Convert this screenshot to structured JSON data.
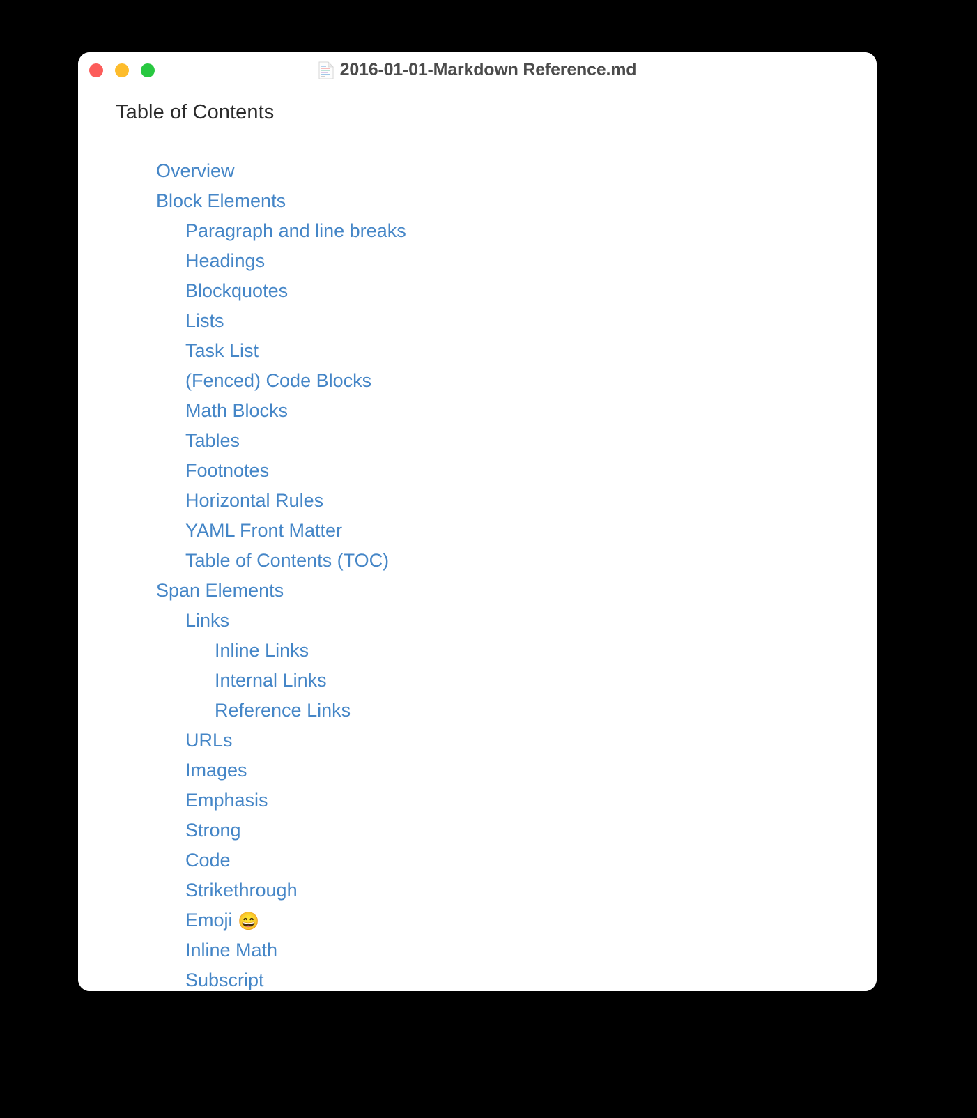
{
  "window": {
    "title": "2016-01-01-Markdown Reference.md",
    "doc_icon": "document-page-icon",
    "traffic_lights": [
      {
        "name": "close",
        "label": "Close",
        "color": "#fc5c5a"
      },
      {
        "name": "minimize",
        "label": "Minimize",
        "color": "#fdbc2c"
      },
      {
        "name": "maximize",
        "label": "Maximize",
        "color": "#28c840"
      }
    ]
  },
  "document": {
    "heading": "Table of Contents",
    "link_color": "#4586c7",
    "heading_color": "#2b2b2b",
    "toc": [
      {
        "label": "Overview",
        "level": 1
      },
      {
        "label": "Block Elements",
        "level": 1
      },
      {
        "label": "Paragraph and line breaks",
        "level": 2
      },
      {
        "label": "Headings",
        "level": 2
      },
      {
        "label": "Blockquotes",
        "level": 2
      },
      {
        "label": "Lists",
        "level": 2
      },
      {
        "label": "Task List",
        "level": 2
      },
      {
        "label": "(Fenced) Code Blocks",
        "level": 2
      },
      {
        "label": "Math Blocks",
        "level": 2
      },
      {
        "label": "Tables",
        "level": 2
      },
      {
        "label": "Footnotes",
        "level": 2
      },
      {
        "label": "Horizontal Rules",
        "level": 2
      },
      {
        "label": "YAML Front Matter",
        "level": 2
      },
      {
        "label": "Table of Contents (TOC)",
        "level": 2
      },
      {
        "label": "Span Elements",
        "level": 1
      },
      {
        "label": "Links",
        "level": 2
      },
      {
        "label": "Inline Links",
        "level": 3
      },
      {
        "label": "Internal Links",
        "level": 3
      },
      {
        "label": "Reference Links",
        "level": 3
      },
      {
        "label": "URLs",
        "level": 2
      },
      {
        "label": "Images",
        "level": 2
      },
      {
        "label": "Emphasis",
        "level": 2
      },
      {
        "label": "Strong",
        "level": 2
      },
      {
        "label": "Code",
        "level": 2
      },
      {
        "label": "Strikethrough",
        "level": 2
      },
      {
        "label": "Emoji ",
        "level": 2,
        "emoji": "😄"
      },
      {
        "label": "Inline Math",
        "level": 2
      },
      {
        "label": "Subscript",
        "level": 2
      }
    ]
  }
}
